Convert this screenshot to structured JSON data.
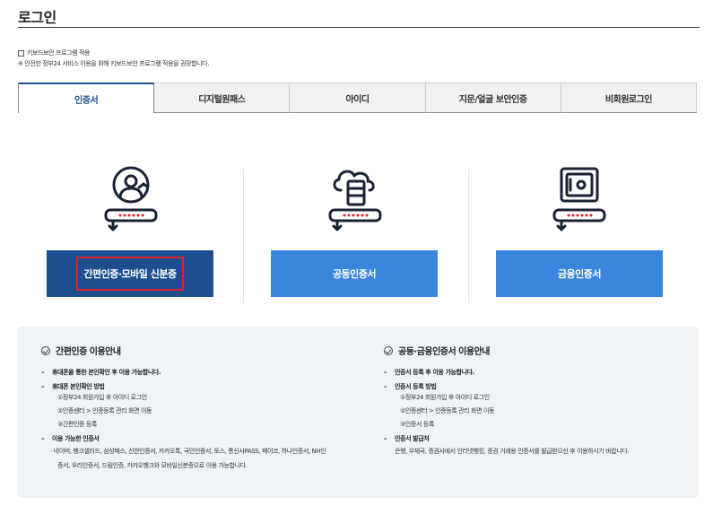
{
  "page": {
    "title": "로그인"
  },
  "keyboard_security": {
    "checkbox_label": "키보드보안 프로그램 적용",
    "note": "※ 안전한 정부24 서비스 이용을 위해 키보드보안 프로그램 적용을 권장합니다."
  },
  "tabs": [
    {
      "label": "인증서",
      "active": true
    },
    {
      "label": "디지털원패스",
      "active": false
    },
    {
      "label": "아이디",
      "active": false
    },
    {
      "label": "지문/얼굴 보안인증",
      "active": false
    },
    {
      "label": "비회원로그인",
      "active": false
    }
  ],
  "methods": [
    {
      "label": "간편인증·모바일 신분증",
      "icon": "person-card-icon"
    },
    {
      "label": "공동인증서",
      "icon": "cloud-server-card-icon"
    },
    {
      "label": "금융인증서",
      "icon": "safe-card-icon"
    }
  ],
  "colors": {
    "primary_dark": "#1d4f8f",
    "primary_light": "#3b86dd",
    "highlight": "#e0202a",
    "guide_bg": "#eef3f8"
  },
  "guide": {
    "simple": {
      "title": "간편인증 이용안내",
      "lines": [
        "휴대폰을 통한 본인확인 후 이용 가능합니다.",
        "휴대폰 본인확인 방법",
        "①정부24 회원가입 후 아이디 로그인",
        "②인증센터 > 인증등록 관리 화면 이동",
        "③간편인증 등록",
        "이용 가능한 인증서",
        "· 네이버, 뱅크샐러드, 삼성패스, 신한인증서, 카카오톡, 국민인증서, 토스, 통신사PASS, 페이코, 하나인증서, NH인",
        "증서, 우리인증서, 드림인증, 카카오뱅크와 모바일신분증으로 이용 가능합니다."
      ]
    },
    "joint": {
      "title": "공동·금융인증서 이용안내",
      "lines": [
        "인증서 등록 후 이용 가능합니다.",
        "인증서 등록 방법",
        "①정부24 회원가입 후 아이디 로그인",
        "②인증센터 > 인증등록 관리 화면 이동",
        "③인증서 등록",
        "인증서 발급처",
        "은행, 우체국, 증권사에서 인터넷뱅킹, 증권 거래용 인증서를 발급받으신 후 이용하시기 바랍니다."
      ]
    }
  }
}
